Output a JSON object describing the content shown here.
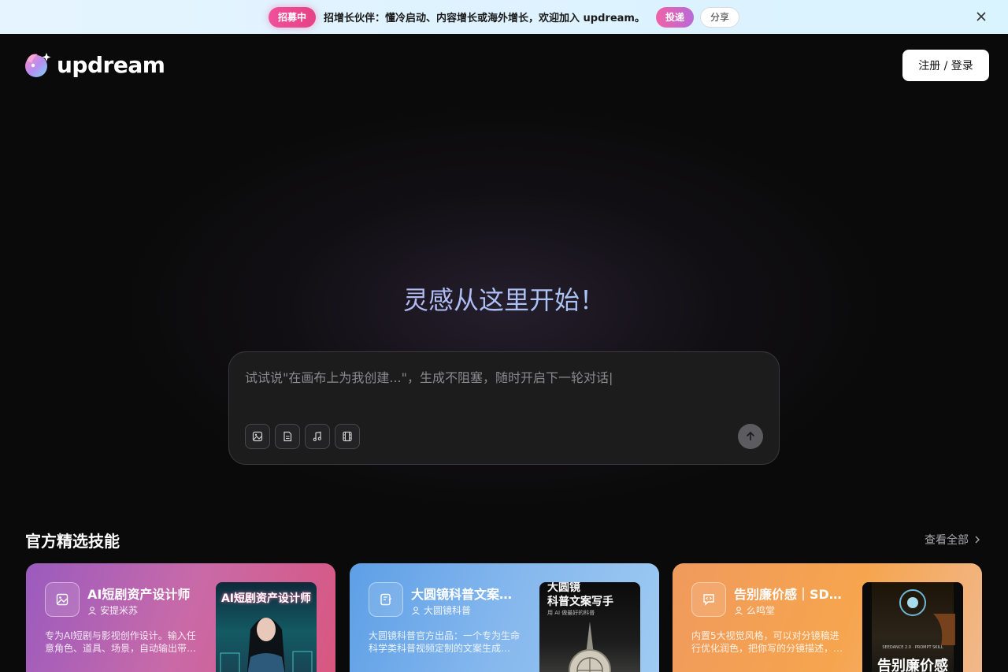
{
  "banner": {
    "badge": "招募中",
    "text": "招增长伙伴：懂冷启动、内容增长或海外增长，欢迎加入 updream。",
    "submit": "投递",
    "share": "分享",
    "close_icon": "close-icon"
  },
  "header": {
    "logo_text": "updream",
    "login": "注册 / 登录"
  },
  "hero": {
    "title": "灵感从这里开始！"
  },
  "prompt": {
    "placeholder": "试试说\"在画布上为我创建...\"，生成不阻塞，随时开启下一轮对话|",
    "value": "",
    "tools": [
      "image-tool-icon",
      "document-tool-icon",
      "music-tool-icon",
      "video-tool-icon"
    ],
    "send_icon": "arrow-up-icon"
  },
  "skills": {
    "title": "官方精选技能",
    "view_all": "查看全部",
    "cards": [
      {
        "title": "AI短剧资产设计师",
        "author": "安提米苏",
        "description": "专为AI短剧与影视创作设计。输入任意角色、道具、场景，自动输出带…",
        "icon": "image-icon",
        "thumb_text": "AI短剧资产设计师"
      },
      {
        "title": "大圆镜科普文案…",
        "author": "大圆镜科普",
        "description": "大圆镜科普官方出品：一个专为生命科学类科普视频定制的文案生成…",
        "icon": "notebook-icon",
        "thumb_text_1": "大圆镜",
        "thumb_text_2": "科普文案写手",
        "thumb_text_3": "用 AI 做最好的科普"
      },
      {
        "title": "告别廉价感｜SD…",
        "author": "么鸣堂",
        "description": "内置5大视觉风格，可以对分镜稿进行优化润色，把你写的分镜描述，…",
        "icon": "code-chat-icon",
        "thumb_text_1": "SEEDANCE 2.0 · PROMPT SKILL",
        "thumb_text_2": "告别廉价感"
      }
    ]
  },
  "colors": {
    "background": "#0a0a0a",
    "banner_bg": "#dff3ff",
    "badge_pink": "#e54287",
    "prompt_bg": "#1c1c1d"
  }
}
